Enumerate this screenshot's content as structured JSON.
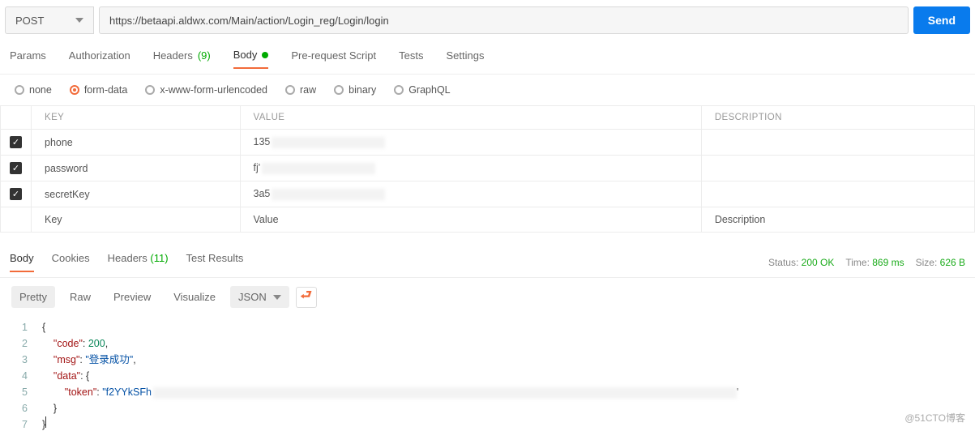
{
  "request": {
    "method": "POST",
    "url": "https://betaapi.aldwx.com/Main/action/Login_reg/Login/login",
    "send_label": "Send"
  },
  "request_tabs": {
    "params": "Params",
    "authorization": "Authorization",
    "headers": "Headers",
    "headers_count": "(9)",
    "body": "Body",
    "prerequest": "Pre-request Script",
    "tests": "Tests",
    "settings": "Settings"
  },
  "body_types": {
    "none": "none",
    "form_data": "form-data",
    "xwww": "x-www-form-urlencoded",
    "raw": "raw",
    "binary": "binary",
    "graphql": "GraphQL"
  },
  "form_header": {
    "key": "KEY",
    "value": "VALUE",
    "description": "DESCRIPTION"
  },
  "form_rows": [
    {
      "key": "phone",
      "value_prefix": "135"
    },
    {
      "key": "password",
      "value_prefix": "fj'"
    },
    {
      "key": "secretKey",
      "value_prefix": "3a5"
    }
  ],
  "form_placeholder": {
    "key": "Key",
    "value": "Value",
    "description": "Description"
  },
  "response_tabs": {
    "body": "Body",
    "cookies": "Cookies",
    "headers": "Headers",
    "headers_count": "(11)",
    "tests": "Test Results"
  },
  "response_meta": {
    "status_label": "Status:",
    "status_value": "200 OK",
    "time_label": "Time:",
    "time_value": "869 ms",
    "size_label": "Size:",
    "size_value": "626 B"
  },
  "view_modes": {
    "pretty": "Pretty",
    "raw": "Raw",
    "preview": "Preview",
    "visualize": "Visualize",
    "format": "JSON"
  },
  "json_body": {
    "code_key": "\"code\"",
    "code_val": "200",
    "msg_key": "\"msg\"",
    "msg_val": "\"登录成功\"",
    "data_key": "\"data\"",
    "token_key": "\"token\"",
    "token_val": "\"f2YYkSFh"
  },
  "watermark": "@51CTO博客"
}
